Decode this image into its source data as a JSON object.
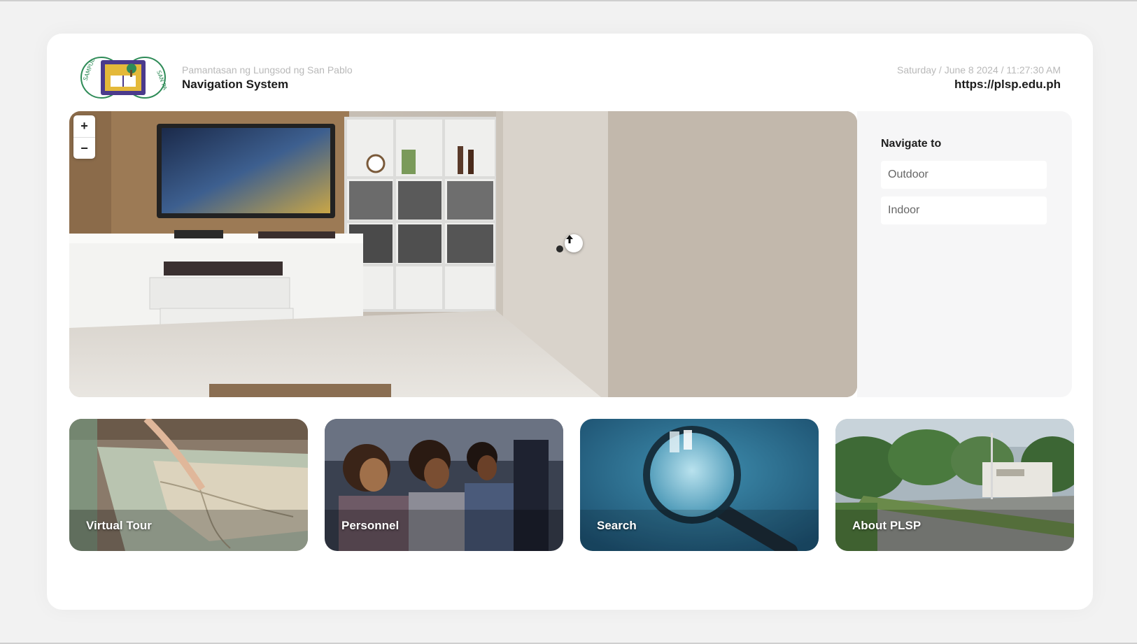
{
  "header": {
    "university_name": "Pamantasan ng Lungsod ng San Pablo",
    "system_title": "Navigation System",
    "datetime": "Saturday / June 8 2024 / 11:27:30 AM",
    "url": "https://plsp.edu.ph"
  },
  "logo": {
    "icon": "plsp-seal-logo"
  },
  "viewer": {
    "zoom_in_label": "+",
    "zoom_out_label": "−",
    "hotspot_icon": "arrow-up-icon"
  },
  "navigate": {
    "heading": "Navigate to",
    "options": [
      {
        "label": "Outdoor"
      },
      {
        "label": "Indoor"
      }
    ]
  },
  "tiles": [
    {
      "label": "Virtual Tour",
      "icon": "map-photo"
    },
    {
      "label": "Personnel",
      "icon": "people-photo"
    },
    {
      "label": "Search",
      "icon": "magnifier-photo"
    },
    {
      "label": "About PLSP",
      "icon": "campus-photo"
    }
  ]
}
